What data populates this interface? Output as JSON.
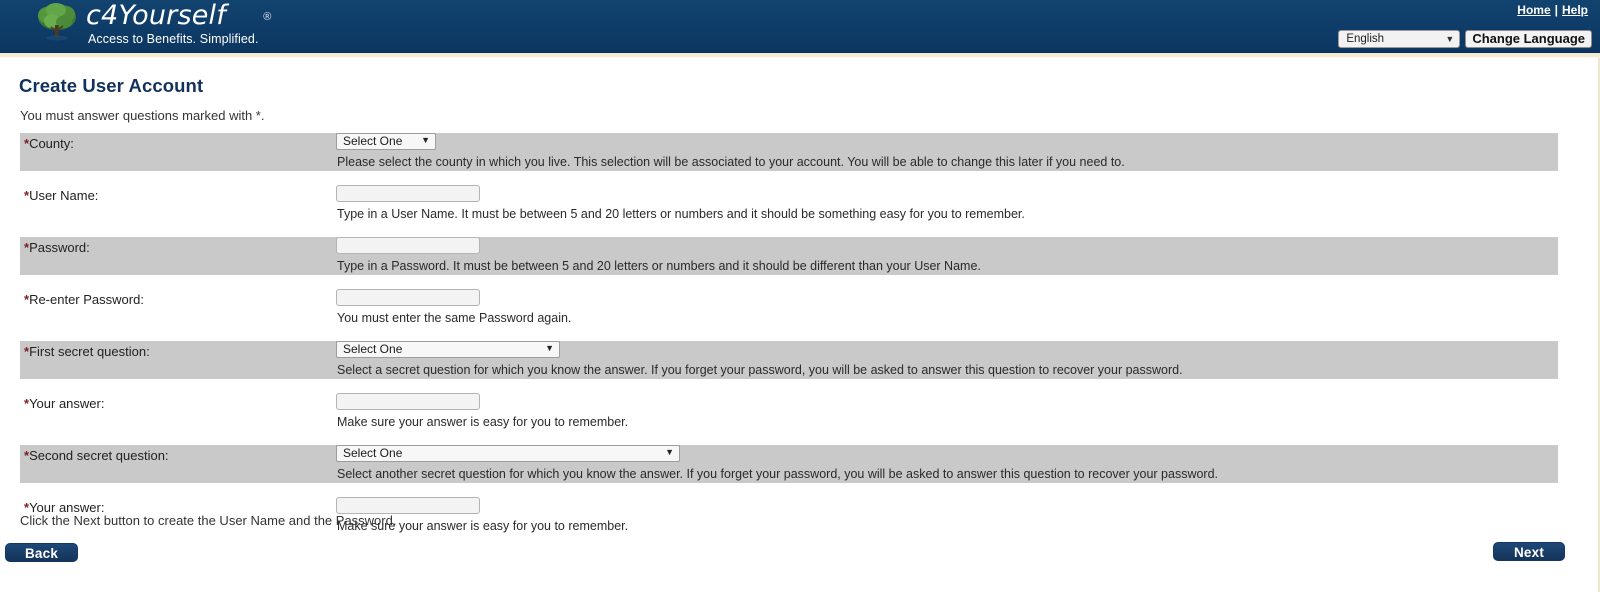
{
  "header": {
    "brand_name": "c4Yourself",
    "brand_registered_mark": "®",
    "tagline": "Access to Benefits.  Simplified.",
    "logo_icon": "tree-icon",
    "home_link": "Home",
    "link_separator": "|",
    "help_link": "Help",
    "language_value": "English",
    "language_caret": "▼",
    "change_language_label": "Change Language",
    "navy": "#0e3d6b",
    "gold": "#f4ecd2"
  },
  "main": {
    "title": "Create User Account",
    "subtitle": "You must answer questions marked with *.",
    "closing_text": "Click the Next button to create the User Name and the Password.",
    "required_marker": "*",
    "caret": "▼",
    "fields": [
      {
        "label": "County:",
        "required": true,
        "control": "select",
        "value": "Select One",
        "help": "Please select the county in which you live. This selection will be associated to your account. You will be able to change this later if you need to.",
        "shaded": true
      },
      {
        "label": "User Name:",
        "required": true,
        "control": "text",
        "value": "",
        "help": "Type in a User Name. It must be between 5 and 20 letters or numbers and it should be something easy for you to remember.",
        "shaded": false
      },
      {
        "label": "Password:",
        "required": true,
        "control": "password",
        "value": "",
        "help": "Type in a Password. It must be between 5 and 20 letters or numbers and it should be different than your User Name.",
        "shaded": true
      },
      {
        "label": "Re-enter Password:",
        "required": true,
        "control": "password",
        "value": "",
        "help": "You must enter the same Password again.",
        "shaded": false
      },
      {
        "label": "First secret question:",
        "required": true,
        "control": "select",
        "value": "Select One",
        "help": "Select a secret question for which you know the answer. If you forget your password, you will be asked to answer this question to recover your password.",
        "shaded": true
      },
      {
        "label": "Your answer:",
        "required": true,
        "control": "text",
        "value": "",
        "help": "Make sure your answer is easy for you to remember.",
        "shaded": false
      },
      {
        "label": "Second secret question:",
        "required": true,
        "control": "select",
        "value": "Select One",
        "help": "Select another secret question for which you know the answer. If you forget your password, you will be asked to answer this question to recover your password.",
        "shaded": true
      },
      {
        "label": "Your answer:",
        "required": true,
        "control": "text",
        "value": "",
        "help": "Make sure your answer is easy for you to remember.",
        "shaded": false
      }
    ]
  },
  "footer": {
    "back_label": "Back",
    "next_label": "Next"
  }
}
